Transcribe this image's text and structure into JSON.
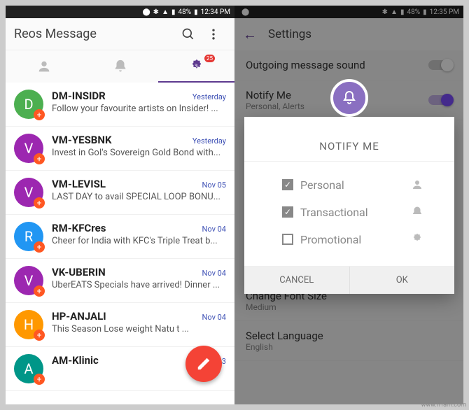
{
  "watermark": "www.frfam.com",
  "left": {
    "status": {
      "battery": "48%",
      "time": "12:34 PM"
    },
    "title": "Reos Message",
    "promo_badge": "25",
    "conversations": [
      {
        "initial": "D",
        "color": "#4caf50",
        "name": "DM-INSIDR",
        "date": "Yesterday",
        "snippet": "Follow your favourite artists on Insider! ..."
      },
      {
        "initial": "V",
        "color": "#9c27b0",
        "name": "VM-YESBNK",
        "date": "Yesterday",
        "snippet": "Invest in GoI's Sovereign Gold Bond with..."
      },
      {
        "initial": "V",
        "color": "#9c27b0",
        "name": "VM-LEVISL",
        "date": "Nov 05",
        "snippet": "LAST DAY to avail SPECIAL LOOP BONU..."
      },
      {
        "initial": "R",
        "color": "#2196f3",
        "name": "RM-KFCres",
        "date": "Nov 04",
        "snippet": "Cheer for India with KFC's Triple Treat b..."
      },
      {
        "initial": "V",
        "color": "#9c27b0",
        "name": "VK-UBERIN",
        "date": "Nov 04",
        "snippet": "UberEATS Specials have arrived! Dinner ..."
      },
      {
        "initial": "H",
        "color": "#ff9800",
        "name": "HP-ANJALI",
        "date": "Nov 04",
        "snippet": "This Season Lose weight Natu       t ..."
      },
      {
        "initial": "A",
        "color": "#009688",
        "name": "AM-Klinic",
        "date": "Nov 03",
        "snippet": ""
      }
    ]
  },
  "right": {
    "status": {
      "battery": "48%",
      "time": "12:35 PM"
    },
    "title": "Settings",
    "rows": {
      "outgoing": "Outgoing message sound",
      "notify": "Notify Me",
      "notify_sub": "Personal, Alerts",
      "font": "Change Font Size",
      "font_sub": "Medium",
      "lang": "Select Language",
      "lang_sub": "English"
    },
    "dialog": {
      "title": "NOTIFY ME",
      "personal": "Personal",
      "transactional": "Transactional",
      "promotional": "Promotional",
      "cancel": "CANCEL",
      "ok": "OK"
    }
  }
}
